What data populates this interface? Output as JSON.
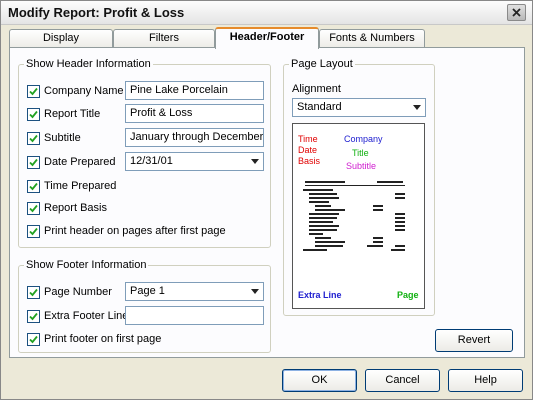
{
  "window": {
    "title": "Modify Report: Profit & Loss"
  },
  "tabs": [
    {
      "label": "Display",
      "active": false
    },
    {
      "label": "Filters",
      "active": false
    },
    {
      "label": "Header/Footer",
      "active": true
    },
    {
      "label": "Fonts & Numbers",
      "active": false
    }
  ],
  "header": {
    "group_label": "Show Header Information",
    "company_name": {
      "label": "Company Name",
      "checked": true,
      "value": "Pine Lake Porcelain"
    },
    "report_title": {
      "label": "Report Title",
      "checked": true,
      "value": "Profit & Loss"
    },
    "subtitle": {
      "label": "Subtitle",
      "checked": true,
      "value": "January through December..."
    },
    "date_prepared": {
      "label": "Date Prepared",
      "checked": true,
      "value": "12/31/01"
    },
    "time_prepared": {
      "label": "Time Prepared",
      "checked": true
    },
    "report_basis": {
      "label": "Report Basis",
      "checked": true
    },
    "print_header": {
      "label": "Print header on pages after first page",
      "checked": true
    }
  },
  "footer": {
    "group_label": "Show Footer Information",
    "page_number": {
      "label": "Page Number",
      "checked": true,
      "value": "Page 1"
    },
    "extra_footer": {
      "label": "Extra Footer Line",
      "checked": true,
      "value": ""
    },
    "print_footer": {
      "label": "Print footer on first page",
      "checked": true
    }
  },
  "layout": {
    "group_label": "Page Layout",
    "alignment_label": "Alignment",
    "alignment_value": "Standard",
    "preview": {
      "time": "Time",
      "date": "Date",
      "basis": "Basis",
      "company": "Company",
      "title": "Title",
      "subtitle": "Subtitle",
      "extra_line": "Extra Line",
      "page": "Page",
      "colors": {
        "red": "#e00000",
        "blue": "#2020d0",
        "green": "#10b010",
        "magenta": "#d020d0"
      }
    }
  },
  "buttons": {
    "revert": "Revert",
    "ok": "OK",
    "cancel": "Cancel",
    "help": "Help"
  }
}
